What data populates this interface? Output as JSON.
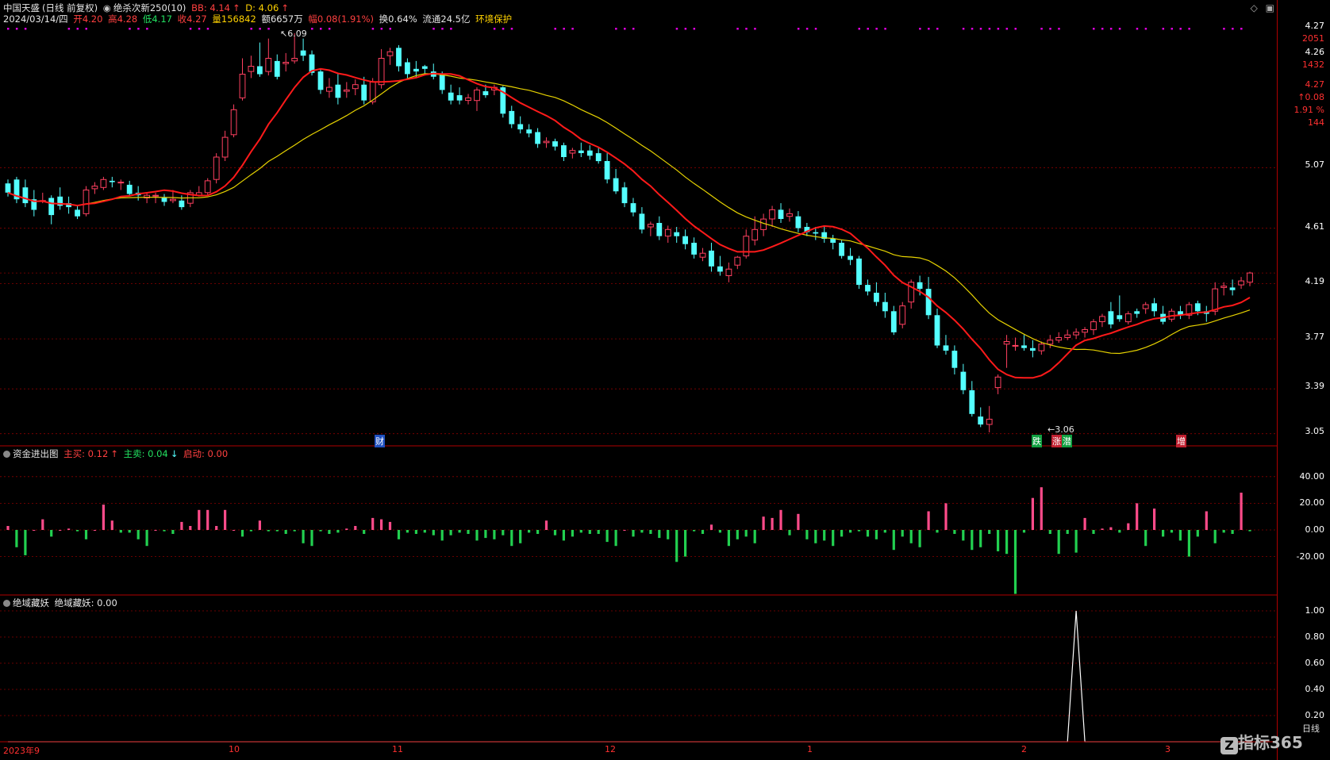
{
  "header": {
    "stock_name": "中国天盛",
    "period": "(日线 前复权)",
    "indicator": "绝杀次新250(10)",
    "bb": "BB: 4.14",
    "d": "D: 4.06",
    "date": "2024/03/14/四",
    "open": "开4.20",
    "high": "高4.28",
    "low": "低4.17",
    "close": "收4.27",
    "volume": "量156842",
    "amount": "额6657万",
    "change": "幅0.08(1.91%)",
    "turnover": "换0.64%",
    "float": "流通24.5亿",
    "env": "环境保护"
  },
  "main_axis": {
    "labels": [
      "5.07",
      "4.61",
      "4.19",
      "3.77",
      "3.39",
      "3.05"
    ],
    "top_values": [
      "4.27",
      "2051",
      "4.26",
      "1432"
    ],
    "cursor_values": [
      "4.27",
      "0.08",
      "1.91 %",
      "144"
    ]
  },
  "main_annotations": {
    "high_label": "6.09",
    "low_label": "3.06",
    "signals": [
      "财",
      "跌",
      "涨",
      "潜",
      "增"
    ]
  },
  "fund_panel": {
    "title": "资金进出图",
    "buy": "主买: 0.12",
    "sell": "主卖: 0.04",
    "start": "启动: 0.00",
    "axis": [
      "40.00",
      "20.00",
      "0.00",
      "-20.00"
    ]
  },
  "jue_panel": {
    "title": "绝域藏妖",
    "value": "绝域藏妖: 0.00",
    "axis": [
      "1.00",
      "0.80",
      "0.60",
      "0.40",
      "0.20"
    ]
  },
  "months": [
    "2023年9",
    "10",
    "11",
    "12",
    "1",
    "2",
    "3"
  ],
  "footer": {
    "period_label": "日线",
    "brand": "指标365"
  },
  "colors": {
    "up": "#ff4060",
    "down": "#54ffff",
    "ma_short": "#ff1a1a",
    "ma_long": "#e6d200",
    "vol_up": "#ff4b8a",
    "vol_down": "#22d050",
    "grid": "#8a0000"
  },
  "chart_data": {
    "type": "candlestick",
    "candles": [
      [
        4.95,
        4.98,
        4.88,
        4.85
      ],
      [
        4.98,
        5.0,
        4.83,
        4.8
      ],
      [
        4.92,
        4.98,
        4.8,
        4.77
      ],
      [
        4.83,
        4.9,
        4.75,
        4.7
      ],
      [
        4.82,
        4.88,
        4.82,
        4.8
      ],
      [
        4.84,
        4.86,
        4.71,
        4.64
      ],
      [
        4.85,
        4.92,
        4.78,
        4.75
      ],
      [
        4.8,
        4.85,
        4.77,
        4.72
      ],
      [
        4.75,
        4.78,
        4.7,
        4.68
      ],
      [
        4.72,
        4.93,
        4.9,
        4.7
      ],
      [
        4.91,
        4.96,
        4.93,
        4.87
      ],
      [
        4.92,
        5.0,
        4.98,
        4.9
      ],
      [
        4.97,
        5.0,
        4.96,
        4.92
      ],
      [
        4.96,
        4.98,
        4.96,
        4.9
      ],
      [
        4.94,
        4.97,
        4.87,
        4.85
      ],
      [
        4.88,
        4.93,
        4.86,
        4.82
      ],
      [
        4.84,
        4.88,
        4.86,
        4.8
      ],
      [
        4.86,
        4.88,
        4.86,
        4.8
      ],
      [
        4.84,
        4.87,
        4.81,
        4.78
      ],
      [
        4.82,
        4.9,
        4.83,
        4.8
      ],
      [
        4.82,
        4.86,
        4.77,
        4.75
      ],
      [
        4.8,
        4.9,
        4.88,
        4.77
      ],
      [
        4.86,
        4.93,
        4.88,
        4.85
      ],
      [
        4.88,
        4.99,
        4.97,
        4.86
      ],
      [
        4.98,
        5.18,
        5.15,
        4.95
      ],
      [
        5.15,
        5.35,
        5.3,
        5.12
      ],
      [
        5.32,
        5.55,
        5.51,
        5.3
      ],
      [
        5.6,
        5.9,
        5.78,
        5.58
      ],
      [
        5.8,
        5.92,
        5.84,
        5.75
      ],
      [
        5.84,
        6.02,
        5.78,
        5.76
      ],
      [
        5.8,
        6.05,
        5.9,
        5.77
      ],
      [
        5.88,
        5.93,
        5.76,
        5.74
      ],
      [
        5.86,
        5.94,
        5.87,
        5.8
      ],
      [
        5.88,
        6.09,
        5.9,
        5.86
      ],
      [
        5.96,
        6.05,
        5.92,
        5.88
      ],
      [
        5.93,
        5.96,
        5.79,
        5.77
      ],
      [
        5.8,
        5.82,
        5.66,
        5.63
      ],
      [
        5.65,
        5.75,
        5.68,
        5.6
      ],
      [
        5.7,
        5.78,
        5.6,
        5.55
      ],
      [
        5.65,
        5.72,
        5.66,
        5.6
      ],
      [
        5.67,
        5.74,
        5.7,
        5.62
      ],
      [
        5.7,
        5.76,
        5.58,
        5.55
      ],
      [
        5.57,
        5.75,
        5.72,
        5.55
      ],
      [
        5.7,
        5.97,
        5.9,
        5.67
      ],
      [
        5.92,
        5.98,
        5.95,
        5.85
      ],
      [
        5.98,
        6.0,
        5.84,
        5.8
      ],
      [
        5.87,
        5.9,
        5.78,
        5.75
      ],
      [
        5.82,
        5.88,
        5.8,
        5.75
      ],
      [
        5.84,
        5.85,
        5.82,
        5.78
      ],
      [
        5.8,
        5.86,
        5.76,
        5.74
      ],
      [
        5.78,
        5.8,
        5.66,
        5.63
      ],
      [
        5.64,
        5.7,
        5.58,
        5.55
      ],
      [
        5.62,
        5.68,
        5.58,
        5.55
      ],
      [
        5.58,
        5.63,
        5.6,
        5.55
      ],
      [
        5.58,
        5.68,
        5.66,
        5.5
      ],
      [
        5.65,
        5.7,
        5.62,
        5.6
      ],
      [
        5.66,
        5.7,
        5.68,
        5.62
      ],
      [
        5.68,
        5.69,
        5.48,
        5.45
      ],
      [
        5.5,
        5.54,
        5.4,
        5.37
      ],
      [
        5.4,
        5.46,
        5.36,
        5.33
      ],
      [
        5.36,
        5.4,
        5.33,
        5.3
      ],
      [
        5.34,
        5.37,
        5.25,
        5.22
      ],
      [
        5.26,
        5.3,
        5.27,
        5.22
      ],
      [
        5.27,
        5.29,
        5.23,
        5.2
      ],
      [
        5.24,
        5.26,
        5.15,
        5.12
      ],
      [
        5.18,
        5.22,
        5.2,
        5.14
      ],
      [
        5.2,
        5.26,
        5.18,
        5.15
      ],
      [
        5.2,
        5.24,
        5.16,
        5.13
      ],
      [
        5.18,
        5.22,
        5.12,
        5.1
      ],
      [
        5.12,
        5.18,
        4.98,
        4.95
      ],
      [
        4.99,
        5.06,
        4.89,
        4.87
      ],
      [
        4.92,
        4.96,
        4.8,
        4.77
      ],
      [
        4.8,
        4.84,
        4.73,
        4.7
      ],
      [
        4.72,
        4.77,
        4.6,
        4.57
      ],
      [
        4.62,
        4.66,
        4.64,
        4.55
      ],
      [
        4.65,
        4.7,
        4.55,
        4.52
      ],
      [
        4.55,
        4.63,
        4.6,
        4.5
      ],
      [
        4.58,
        4.62,
        4.55,
        4.5
      ],
      [
        4.55,
        4.6,
        4.49,
        4.45
      ],
      [
        4.5,
        4.54,
        4.41,
        4.38
      ],
      [
        4.39,
        4.46,
        4.42,
        4.36
      ],
      [
        4.44,
        4.5,
        4.32,
        4.28
      ],
      [
        4.32,
        4.4,
        4.28,
        4.25
      ],
      [
        4.25,
        4.35,
        4.3,
        4.2
      ],
      [
        4.33,
        4.4,
        4.39,
        4.3
      ],
      [
        4.4,
        4.6,
        4.55,
        4.38
      ],
      [
        4.52,
        4.7,
        4.6,
        4.48
      ],
      [
        4.6,
        4.72,
        4.68,
        4.55
      ],
      [
        4.68,
        4.78,
        4.75,
        4.62
      ],
      [
        4.75,
        4.8,
        4.68,
        4.65
      ],
      [
        4.7,
        4.76,
        4.72,
        4.66
      ],
      [
        4.7,
        4.74,
        4.61,
        4.58
      ],
      [
        4.62,
        4.65,
        4.58,
        4.55
      ],
      [
        4.58,
        4.62,
        4.57,
        4.52
      ],
      [
        4.58,
        4.62,
        4.53,
        4.5
      ],
      [
        4.53,
        4.56,
        4.5,
        4.45
      ],
      [
        4.5,
        4.52,
        4.4,
        4.38
      ],
      [
        4.4,
        4.46,
        4.37,
        4.33
      ],
      [
        4.38,
        4.4,
        4.18,
        4.15
      ],
      [
        4.18,
        4.22,
        4.13,
        4.1
      ],
      [
        4.12,
        4.2,
        4.05,
        4.02
      ],
      [
        4.05,
        4.12,
        3.98,
        3.93
      ],
      [
        3.98,
        4.02,
        3.82,
        3.8
      ],
      [
        3.88,
        4.05,
        4.02,
        3.85
      ],
      [
        4.05,
        4.22,
        4.2,
        4.0
      ],
      [
        4.2,
        4.25,
        4.15,
        4.1
      ],
      [
        4.15,
        4.24,
        3.95,
        3.92
      ],
      [
        3.95,
        4.0,
        3.72,
        3.7
      ],
      [
        3.72,
        3.8,
        3.68,
        3.65
      ],
      [
        3.68,
        3.72,
        3.55,
        3.5
      ],
      [
        3.52,
        3.58,
        3.38,
        3.35
      ],
      [
        3.38,
        3.45,
        3.2,
        3.18
      ],
      [
        3.18,
        3.25,
        3.12,
        3.1
      ],
      [
        3.12,
        3.26,
        3.16,
        3.06
      ],
      [
        3.4,
        3.5,
        3.48,
        3.35
      ],
      [
        3.73,
        3.8,
        3.75,
        3.55
      ],
      [
        3.72,
        3.78,
        3.72,
        3.68
      ],
      [
        3.72,
        3.8,
        3.7,
        3.68
      ],
      [
        3.7,
        3.76,
        3.68,
        3.63
      ],
      [
        3.68,
        3.75,
        3.73,
        3.65
      ],
      [
        3.73,
        3.8,
        3.76,
        3.7
      ],
      [
        3.76,
        3.82,
        3.78,
        3.74
      ],
      [
        3.78,
        3.84,
        3.8,
        3.76
      ],
      [
        3.8,
        3.85,
        3.82,
        3.77
      ],
      [
        3.82,
        3.86,
        3.84,
        3.78
      ],
      [
        3.84,
        3.92,
        3.9,
        3.8
      ],
      [
        3.9,
        3.96,
        3.94,
        3.86
      ],
      [
        3.98,
        4.05,
        3.88,
        3.85
      ],
      [
        3.95,
        4.1,
        3.92,
        3.9
      ],
      [
        3.9,
        3.98,
        3.96,
        3.88
      ],
      [
        3.98,
        4.0,
        3.96,
        3.93
      ],
      [
        4.0,
        4.05,
        4.03,
        3.96
      ],
      [
        4.04,
        4.08,
        3.98,
        3.94
      ],
      [
        3.96,
        4.02,
        3.9,
        3.88
      ],
      [
        3.92,
        4.0,
        3.98,
        3.9
      ],
      [
        3.98,
        4.02,
        3.95,
        3.92
      ],
      [
        3.95,
        4.05,
        4.03,
        3.92
      ],
      [
        4.04,
        4.06,
        3.98,
        3.95
      ],
      [
        3.98,
        4.02,
        3.96,
        3.9
      ],
      [
        3.98,
        4.2,
        4.15,
        3.95
      ],
      [
        4.16,
        4.2,
        4.17,
        4.1
      ],
      [
        4.16,
        4.22,
        4.14,
        4.1
      ],
      [
        4.18,
        4.24,
        4.21,
        4.15
      ],
      [
        4.2,
        4.28,
        4.27,
        4.17
      ]
    ],
    "fund": [
      3,
      -13,
      -19,
      0,
      8,
      -5,
      0,
      1,
      -1,
      -7,
      0,
      19,
      7,
      -2,
      -2,
      -7,
      -12,
      0,
      -1,
      -3,
      6,
      3,
      15,
      15,
      3,
      15,
      0,
      -5,
      -1,
      7,
      -1,
      -1,
      -3,
      -1,
      -10,
      -12,
      -1,
      -3,
      -2,
      1,
      3,
      -3,
      9,
      8,
      6,
      -7,
      -2,
      -3,
      -2,
      -4,
      -8,
      -4,
      -2,
      -3,
      -8,
      -6,
      -7,
      -4,
      -12,
      -10,
      -2,
      -3,
      7,
      -4,
      -8,
      -5,
      -2,
      -3,
      -3,
      -9,
      -12,
      0,
      -5,
      -2,
      -3,
      -6,
      -7,
      -24,
      -20,
      -1,
      -3,
      4,
      -2,
      -12,
      -7,
      -5,
      -10,
      10,
      9,
      15,
      -4,
      12,
      -7,
      -10,
      -8,
      -12,
      -5,
      -2,
      -1,
      -5,
      -7,
      -2,
      -15,
      -5,
      -10,
      -13,
      14,
      -2,
      20,
      -3,
      -8,
      -15,
      -13,
      -3,
      -16,
      -18,
      -48,
      -2,
      24,
      32,
      -3,
      -18,
      -3,
      -17,
      9,
      -3,
      1,
      2,
      -2,
      5,
      20,
      -12,
      16,
      -5,
      -2,
      -8,
      -20,
      -5,
      14,
      -10,
      -2,
      -3,
      28,
      -1,
      -13,
      7
    ],
    "jue": [
      {
        "index": 123,
        "value": 1.0
      }
    ],
    "ma_period": [
      "short",
      "long"
    ]
  }
}
